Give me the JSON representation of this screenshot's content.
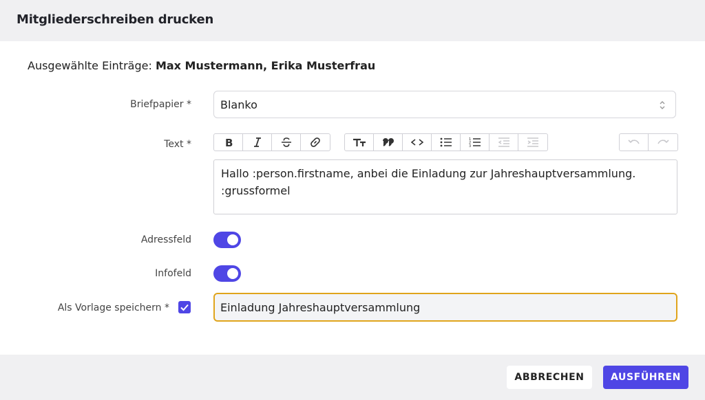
{
  "dialog": {
    "title": "Mitgliederschreiben drucken"
  },
  "selection": {
    "prefix": "Ausgewählte Einträge:",
    "names": "Max Mustermann, Erika Musterfrau"
  },
  "form": {
    "letterhead": {
      "label": "Briefpapier *",
      "value": "Blanko"
    },
    "text": {
      "label": "Text *",
      "line1": "Hallo :person.firstname, anbei die Einladung zur Jahreshauptversammlung.",
      "line2": ":grussformel"
    },
    "address_field": {
      "label": "Adressfeld",
      "enabled": true
    },
    "info_field": {
      "label": "Infofeld",
      "enabled": true
    },
    "save_template": {
      "label": "Als Vorlage speichern *",
      "checked": true,
      "value": "Einladung Jahreshauptversammlung"
    }
  },
  "toolbar": {
    "group1": [
      "bold-icon",
      "italic-icon",
      "strikethrough-icon",
      "link-icon"
    ],
    "group2": [
      "heading-icon",
      "quote-icon",
      "code-icon",
      "bullet-list-icon",
      "numbered-list-icon",
      "outdent-icon",
      "indent-icon"
    ],
    "group3": [
      "undo-icon",
      "redo-icon"
    ]
  },
  "footer": {
    "cancel_label": "ABBRECHEN",
    "run_label": "AUSFÜHREN"
  },
  "colors": {
    "accent": "#4f46e5",
    "focus_border": "#e0a41b",
    "header_bg": "#f0f0f2"
  }
}
